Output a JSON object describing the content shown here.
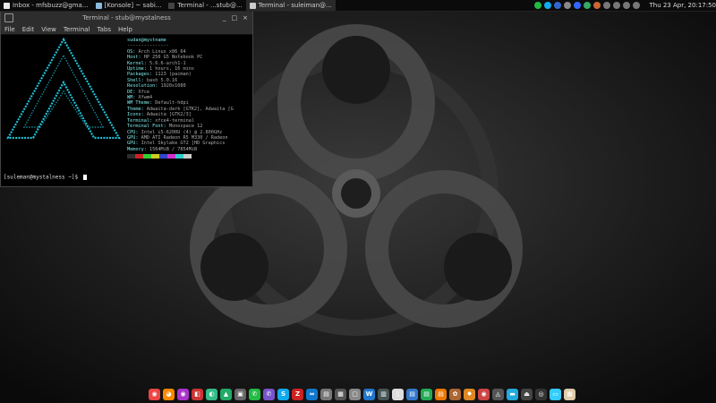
{
  "taskbar": {
    "tasks": [
      {
        "label": "Inbox - mfsbuzz@gma...",
        "color": "#e8e8e8"
      },
      {
        "label": "[Konsole] ~ sabi...",
        "color": "#8bd"
      },
      {
        "label": "Terminal - ...stub@...",
        "color": "#444"
      },
      {
        "label": "Terminal - suleiman@...",
        "color": "#ccc"
      }
    ],
    "clock": "Thu 23 Apr, 20:17:50"
  },
  "terminal": {
    "title": "Terminal - stub@mystalness",
    "menu": [
      "File",
      "Edit",
      "View",
      "Terminal",
      "Tabs",
      "Help"
    ],
    "controls": [
      "_",
      "□",
      "×"
    ],
    "prompt": "[suleman@mystalness ~]$ "
  },
  "neofetch": {
    "user_host": "sudan@mystname",
    "separator": "---------------",
    "lines": [
      {
        "key": "OS:",
        "value": "Arch Linux x86_64"
      },
      {
        "key": "Host:",
        "value": "HP 250 G5 Notebook PC"
      },
      {
        "key": "Kernel:",
        "value": "5.6.6-arch1-1"
      },
      {
        "key": "Uptime:",
        "value": "1 hours, 16 mins"
      },
      {
        "key": "Packages:",
        "value": "1123 (pacman)"
      },
      {
        "key": "Shell:",
        "value": "bash 5.0.16"
      },
      {
        "key": "Resolution:",
        "value": "1920x1080"
      },
      {
        "key": "DE:",
        "value": "Xfce"
      },
      {
        "key": "WM:",
        "value": "Xfwm4"
      },
      {
        "key": "WM Theme:",
        "value": "Default-hdpi"
      },
      {
        "key": "Theme:",
        "value": "Adwaita-dark [GTK2], Adwaita [G"
      },
      {
        "key": "Icons:",
        "value": "Adwaita [GTK2/3]"
      },
      {
        "key": "Terminal:",
        "value": "xfce4-terminal"
      },
      {
        "key": "Terminal Font:",
        "value": "Monospace 12"
      },
      {
        "key": "CPU:",
        "value": "Intel i5-6200U (4) @ 2.800GHz"
      },
      {
        "key": "GPU:",
        "value": "AMD ATI Radeon R5 M330 / Radeon"
      },
      {
        "key": "GPU:",
        "value": "Intel Skylake GT2 [HD Graphics"
      },
      {
        "key": "Memory:",
        "value": "1564MiB / 7854MiB"
      }
    ],
    "palette": [
      "#2d2d2d",
      "#c22",
      "#3c3",
      "#cc2",
      "#34c",
      "#c3c",
      "#3cc",
      "#ccc"
    ]
  },
  "dock": {
    "icons": [
      {
        "name": "chrome-icon",
        "glyph": "◉",
        "color": "#e44"
      },
      {
        "name": "firefox-icon",
        "glyph": "◕",
        "color": "#f80"
      },
      {
        "name": "app-icon",
        "glyph": "◉",
        "color": "#a3c"
      },
      {
        "name": "app-icon",
        "glyph": "◧",
        "color": "#c33"
      },
      {
        "name": "app-icon",
        "glyph": "◐",
        "color": "#3b8"
      },
      {
        "name": "app-icon",
        "glyph": "▲",
        "color": "#2a6"
      },
      {
        "name": "app-icon",
        "glyph": "▣",
        "color": "#666"
      },
      {
        "name": "whatsapp-icon",
        "glyph": "✆",
        "color": "#2b4"
      },
      {
        "name": "viber-icon",
        "glyph": "✆",
        "color": "#75c"
      },
      {
        "name": "skype-icon",
        "glyph": "S",
        "color": "#1ae"
      },
      {
        "name": "filezilla-icon",
        "glyph": "Z",
        "color": "#c22"
      },
      {
        "name": "teamviewer-icon",
        "glyph": "⇔",
        "color": "#17c"
      },
      {
        "name": "app-icon",
        "glyph": "▤",
        "color": "#777"
      },
      {
        "name": "app-icon",
        "glyph": "▦",
        "color": "#555"
      },
      {
        "name": "app-icon",
        "glyph": "▢",
        "color": "#888"
      },
      {
        "name": "app-icon",
        "glyph": "W",
        "color": "#27c"
      },
      {
        "name": "app-icon",
        "glyph": "▥",
        "color": "#455"
      },
      {
        "name": "app-icon",
        "glyph": "▯",
        "color": "#ddd"
      },
      {
        "name": "app-icon",
        "glyph": "▤",
        "color": "#37c"
      },
      {
        "name": "app-icon",
        "glyph": "▤",
        "color": "#2a5"
      },
      {
        "name": "app-icon",
        "glyph": "▤",
        "color": "#e70"
      },
      {
        "name": "app-icon",
        "glyph": "✿",
        "color": "#a63"
      },
      {
        "name": "app-icon",
        "glyph": "✸",
        "color": "#d82"
      },
      {
        "name": "app-icon",
        "glyph": "◉",
        "color": "#c44"
      },
      {
        "name": "app-icon",
        "glyph": "◬",
        "color": "#555"
      },
      {
        "name": "app-icon",
        "glyph": "▬",
        "color": "#2ad"
      },
      {
        "name": "app-icon",
        "glyph": "⏏",
        "color": "#444"
      },
      {
        "name": "app-icon",
        "glyph": "◎",
        "color": "#333"
      },
      {
        "name": "app-icon",
        "glyph": "▭",
        "color": "#3cf"
      },
      {
        "name": "app-icon",
        "glyph": "▦",
        "color": "#dca"
      }
    ]
  },
  "tray": {
    "icons": [
      {
        "name": "whatsapp-icon",
        "color": "#2b4"
      },
      {
        "name": "skype-icon",
        "color": "#1ae"
      },
      {
        "name": "mail-icon",
        "color": "#36c"
      },
      {
        "name": "clipboard-icon",
        "color": "#888"
      },
      {
        "name": "bluetooth-icon",
        "color": "#36f"
      },
      {
        "name": "app-icon",
        "color": "#3a6"
      },
      {
        "name": "app-icon",
        "color": "#c63"
      },
      {
        "name": "battery-icon",
        "color": "#777"
      },
      {
        "name": "network-icon",
        "color": "#777"
      },
      {
        "name": "volume-icon",
        "color": "#777"
      },
      {
        "name": "notifications-icon",
        "color": "#777"
      }
    ]
  }
}
